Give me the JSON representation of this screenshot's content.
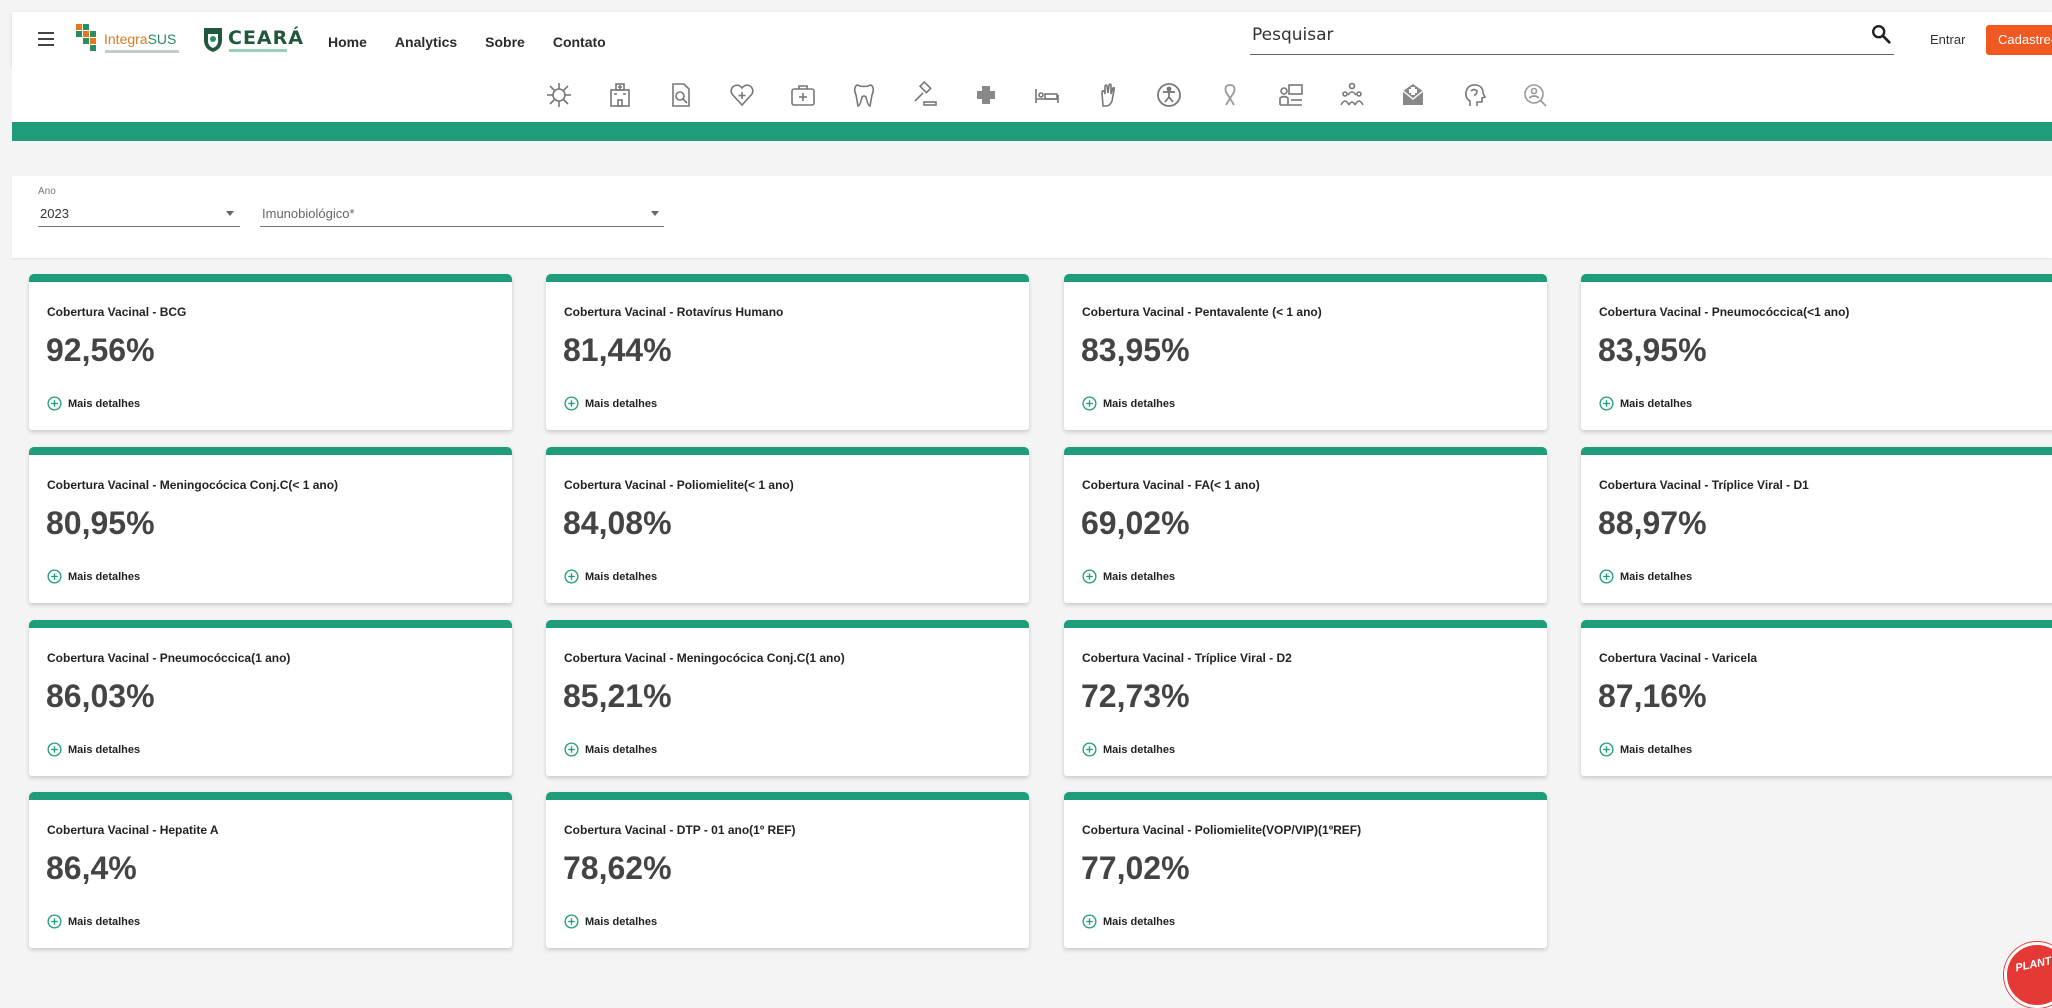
{
  "header": {
    "logo_integra": {
      "part1": "Integra",
      "part2": "SUS"
    },
    "logo_ceara": "CEARÁ",
    "nav": [
      "Home",
      "Analytics",
      "Sobre",
      "Contato"
    ],
    "search_placeholder": "Pesquisar",
    "login_label": "Entrar",
    "signup_label": "Cadastre-se"
  },
  "category_icons": [
    "virus-icon",
    "hospital-icon",
    "document-search-icon",
    "heart-plus-icon",
    "medical-kit-icon",
    "tooth-icon",
    "gavel-icon",
    "medical-cross-icon",
    "hospital-bed-icon",
    "hand-icon",
    "accessibility-icon",
    "ribbon-icon",
    "worker-icon",
    "family-icon",
    "envelope-cross-icon",
    "head-mind-icon",
    "magnifier-person-icon"
  ],
  "colors": {
    "accent": "#1f9d7a",
    "signup": "#f05a22",
    "badge": "#e53935"
  },
  "filters": {
    "ano": {
      "label": "Ano",
      "value": "2023"
    },
    "imunobiologico": {
      "placeholder": "Imunobiológico*"
    }
  },
  "more_label": "Mais detalhes",
  "cards": [
    {
      "title": "Cobertura Vacinal - BCG",
      "value": "92,56%"
    },
    {
      "title": "Cobertura Vacinal - Rotavírus Humano",
      "value": "81,44%"
    },
    {
      "title": "Cobertura Vacinal - Pentavalente (< 1 ano)",
      "value": "83,95%"
    },
    {
      "title": "Cobertura Vacinal - Pneumocóccica(<1 ano)",
      "value": "83,95%"
    },
    {
      "title": "Cobertura Vacinal - Meningocócica Conj.C(< 1 ano)",
      "value": "80,95%"
    },
    {
      "title": "Cobertura Vacinal - Poliomielite(< 1 ano)",
      "value": "84,08%"
    },
    {
      "title": "Cobertura Vacinal - FA(< 1 ano)",
      "value": "69,02%"
    },
    {
      "title": "Cobertura Vacinal - Tríplice Viral - D1",
      "value": "88,97%"
    },
    {
      "title": "Cobertura Vacinal - Pneumocóccica(1 ano)",
      "value": "86,03%"
    },
    {
      "title": "Cobertura Vacinal - Meningocócica Conj.C(1 ano)",
      "value": "85,21%"
    },
    {
      "title": "Cobertura Vacinal - Tríplice Viral - D2",
      "value": "72,73%"
    },
    {
      "title": "Cobertura Vacinal - Varicela",
      "value": "87,16%"
    },
    {
      "title": "Cobertura Vacinal - Hepatite A",
      "value": "86,4%"
    },
    {
      "title": "Cobertura Vacinal - DTP - 01 ano(1º REF)",
      "value": "78,62%"
    },
    {
      "title": "Cobertura Vacinal - Poliomielite(VOP/VIP)(1ºREF)",
      "value": "77,02%"
    }
  ],
  "badge_text": "PLANTÃO"
}
